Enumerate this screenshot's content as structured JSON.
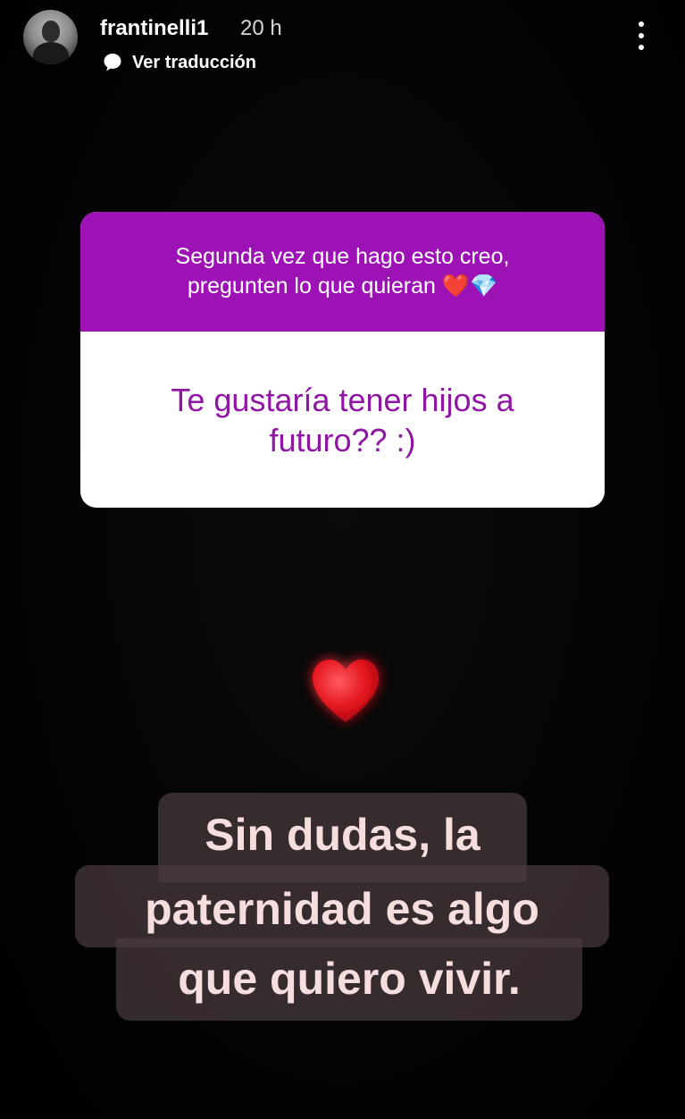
{
  "header": {
    "username": "frantinelli1",
    "time": "20 h",
    "translate_label": "Ver traducción",
    "avatar_icon": "profile-avatar",
    "translate_icon": "speech-bubble-icon",
    "more_icon": "vertical-dots-icon"
  },
  "question_sticker": {
    "prompt_line1": "Segunda vez que hago esto creo,",
    "prompt_line2": "pregunten lo que quieran ❤️💎",
    "answer_line1": "Te gustaría tener hijos a",
    "answer_line2": "futuro?? :)",
    "prompt_color": "#9d12b4",
    "answer_color": "#8f17a4"
  },
  "sticker_heart": {
    "icon": "red-heart-icon",
    "color": "#e3141d"
  },
  "reply": {
    "line1": "Sin dudas, la",
    "line2": "paternidad es algo",
    "line3": "que quiero vivir.",
    "text_color": "#f7dede"
  }
}
